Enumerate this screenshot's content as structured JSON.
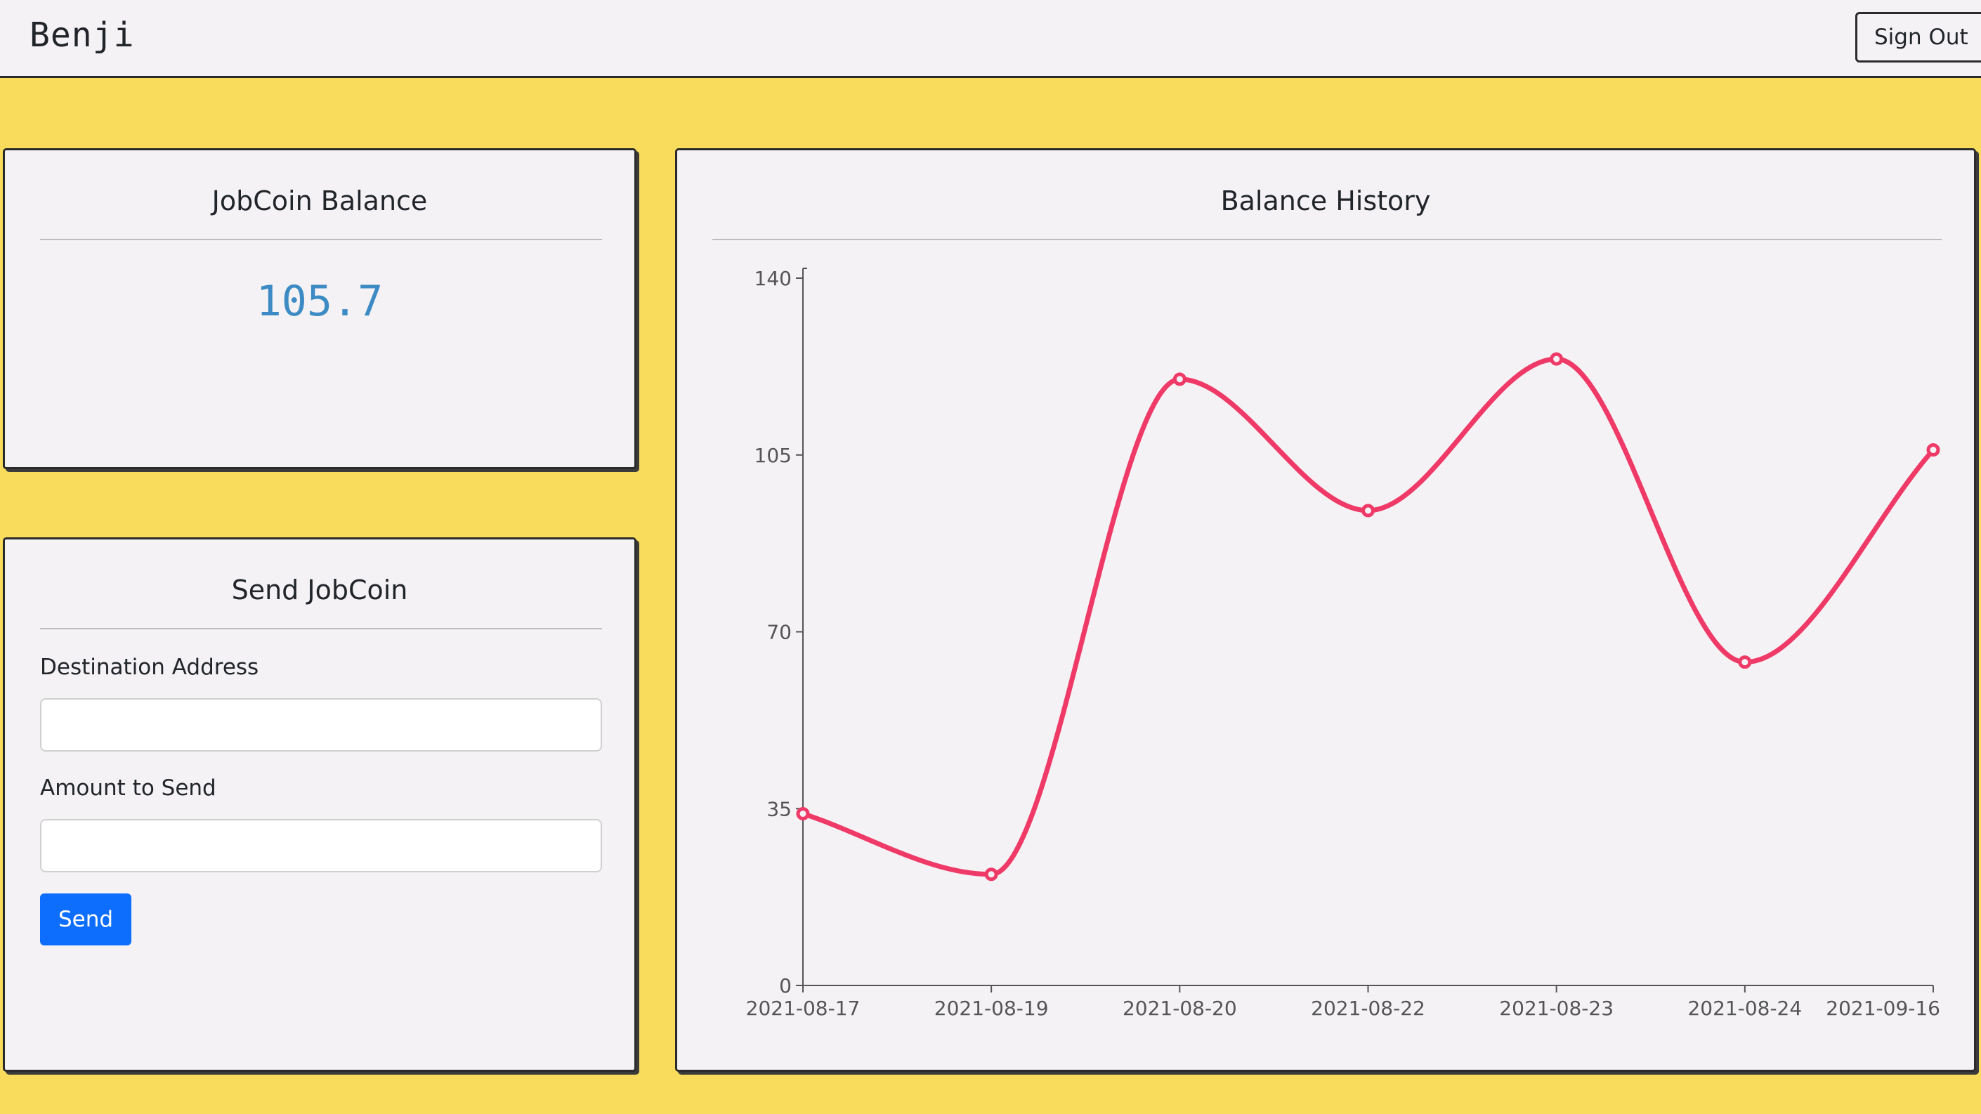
{
  "navbar": {
    "brand": "Benji",
    "sign_out_label": "Sign Out"
  },
  "balance_card": {
    "title": "JobCoin Balance",
    "value": "105.7",
    "value_color": "#3d8bc4"
  },
  "send_card": {
    "title": "Send JobCoin",
    "destination_label": "Destination Address",
    "destination_value": "",
    "amount_label": "Amount to Send",
    "amount_value": "",
    "send_label": "Send",
    "send_color": "#0d6efd"
  },
  "history_card": {
    "title": "Balance History"
  },
  "colors": {
    "page_background": "#f9dc5c",
    "card_background": "#f4f2f5",
    "line": "#ef3a68"
  },
  "chart_data": {
    "type": "line",
    "title": "Balance History",
    "xlabel": "",
    "ylabel": "",
    "categories": [
      "2021-08-17",
      "2021-08-19",
      "2021-08-20",
      "2021-08-22",
      "2021-08-23",
      "2021-08-24",
      "2021-09-16"
    ],
    "series": [
      {
        "values": [
          34,
          22,
          120,
          94,
          124,
          64,
          106
        ]
      }
    ],
    "ylim": [
      0,
      140
    ],
    "yticks": [
      0,
      35,
      70,
      105,
      140
    ],
    "grid": false,
    "legend": "none",
    "curve": "smooth",
    "color": "#ef3a68"
  }
}
